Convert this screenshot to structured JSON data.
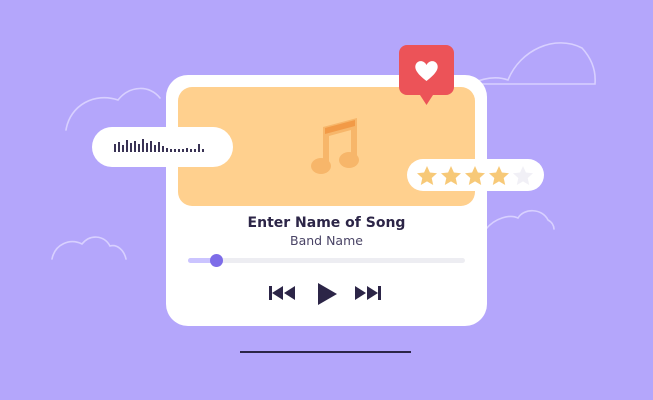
{
  "song": {
    "title": "Enter Name of Song",
    "band": "Band Name"
  },
  "playback": {
    "progress_fraction": 0.1
  },
  "rating": {
    "value": 4,
    "max": 5
  },
  "icons": {
    "artwork": "music-note-icon",
    "like": "heart-icon",
    "previous": "skip-back-icon",
    "play": "play-icon",
    "next": "skip-forward-icon",
    "waveform": "audio-waveform-icon",
    "rating": "star-icon"
  },
  "colors": {
    "background": "#b4a6fb",
    "artwork": "#ffd08e",
    "accent": "#7d6ce8",
    "like_badge": "#ec5358",
    "star_filled": "#f7c978",
    "star_empty": "#f1f0f6",
    "text_dark": "#2c2547"
  }
}
